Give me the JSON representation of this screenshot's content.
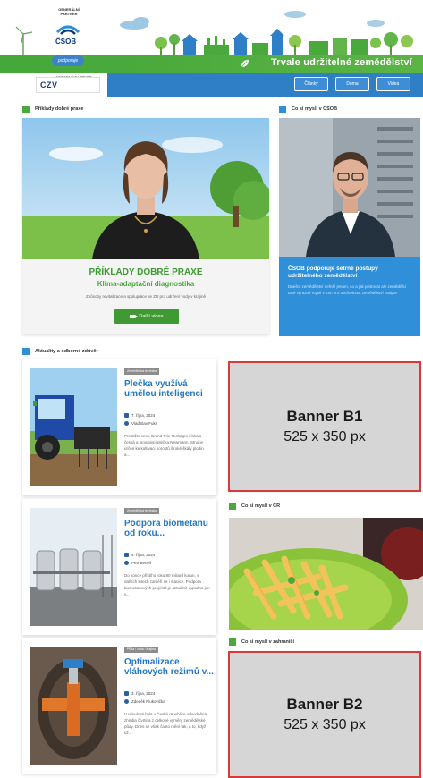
{
  "header": {
    "partner_label": "GENERÁLNÍ PARTNER",
    "csob_name": "ČSOB",
    "podpory_badge": "podporuje",
    "odborny_label": "ODBORNÝ PARTNER",
    "czv_name": "CZV",
    "site_title": "Trvale udržitelné zemědělství",
    "nav": [
      "Články",
      "Doma",
      "Videa"
    ]
  },
  "sections": {
    "priklady": "Příklady dobré praxe",
    "co_si_mysli_csob": "Co si myslí v ČSOB",
    "aktuality": "Aktuality a odborné zdůvěr",
    "co_si_mysli_cr": "Co si myslí v ČR",
    "co_si_mysli_zahranici": "Co si myslí v zahraničí"
  },
  "hero": {
    "title": "PŘÍKLADY DOBRÉ PRAXE",
    "subtitle": "Klima-adaptační diagnostika",
    "description": "Způsoby revitalizace a spolupráce se ZD pro udržení vody v krajině",
    "button": "Další videa"
  },
  "csob_card": {
    "title": "ČSOB podporuje šetrné postupy udržitelného zemědělství",
    "text": "Dnešní zemědělství neřeší jenom, co a jak pěstovat ale zemědělci také výrazně myslí v tom pro udržitelnost zemědělství podpor"
  },
  "articles": [
    {
      "tag": "Zemědělská technika",
      "title": "Plečka využívá umělou inteligenci",
      "date": "7. října, 2024",
      "author": "Vladislav Fuks",
      "excerpt": "Prestižní cenu Grand Prix Techagro získala česká a inovativní plečka Newmann. Stroj je určen ke kultivaci porostů široké škály plodin a..."
    },
    {
      "tag": "Zemědělská technika",
      "title": "Podpora biometanu od roku...",
      "date": "4. října, 2024",
      "author": "Petr Beneš",
      "excerpt": "Do konce příštího roku 80 miliard korun, v dalších letech zaměří se i stanice. Podpora biometanových projektů je aktuálně vypsána jen v..."
    },
    {
      "tag": "Půda / voda / krajina",
      "title": "Optimalizace vláhových režimů v...",
      "date": "3. října, 2024",
      "author": "Zdeněk Plukovička",
      "excerpt": "V minulosti byla v České republice odvodněna zhruba čtvrtina z celkové výměry zemědělské půdy. Dnes se však často mění tak, a to, když už..."
    }
  ],
  "banners": [
    {
      "name": "Banner B1",
      "size": "525 x 350 px"
    },
    {
      "name": "Banner B2",
      "size": "525 x 350 px"
    }
  ],
  "colors": {
    "green": "#4aa93c",
    "blue": "#2f8fd8",
    "banner_border": "#d83a3a",
    "banner_fill": "#d6d6d6"
  }
}
